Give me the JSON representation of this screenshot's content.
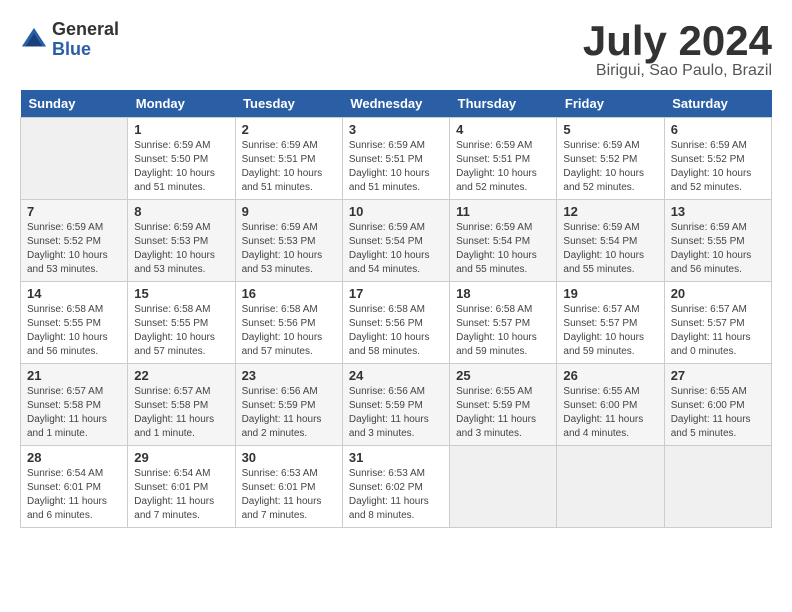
{
  "header": {
    "logo_general": "General",
    "logo_blue": "Blue",
    "title": "July 2024",
    "location": "Birigui, Sao Paulo, Brazil"
  },
  "calendar": {
    "days_of_week": [
      "Sunday",
      "Monday",
      "Tuesday",
      "Wednesday",
      "Thursday",
      "Friday",
      "Saturday"
    ],
    "weeks": [
      [
        {
          "day": "",
          "empty": true
        },
        {
          "day": "1",
          "sunrise": "Sunrise: 6:59 AM",
          "sunset": "Sunset: 5:50 PM",
          "daylight": "Daylight: 10 hours and 51 minutes."
        },
        {
          "day": "2",
          "sunrise": "Sunrise: 6:59 AM",
          "sunset": "Sunset: 5:51 PM",
          "daylight": "Daylight: 10 hours and 51 minutes."
        },
        {
          "day": "3",
          "sunrise": "Sunrise: 6:59 AM",
          "sunset": "Sunset: 5:51 PM",
          "daylight": "Daylight: 10 hours and 51 minutes."
        },
        {
          "day": "4",
          "sunrise": "Sunrise: 6:59 AM",
          "sunset": "Sunset: 5:51 PM",
          "daylight": "Daylight: 10 hours and 52 minutes."
        },
        {
          "day": "5",
          "sunrise": "Sunrise: 6:59 AM",
          "sunset": "Sunset: 5:52 PM",
          "daylight": "Daylight: 10 hours and 52 minutes."
        },
        {
          "day": "6",
          "sunrise": "Sunrise: 6:59 AM",
          "sunset": "Sunset: 5:52 PM",
          "daylight": "Daylight: 10 hours and 52 minutes."
        }
      ],
      [
        {
          "day": "7",
          "sunrise": "Sunrise: 6:59 AM",
          "sunset": "Sunset: 5:52 PM",
          "daylight": "Daylight: 10 hours and 53 minutes."
        },
        {
          "day": "8",
          "sunrise": "Sunrise: 6:59 AM",
          "sunset": "Sunset: 5:53 PM",
          "daylight": "Daylight: 10 hours and 53 minutes."
        },
        {
          "day": "9",
          "sunrise": "Sunrise: 6:59 AM",
          "sunset": "Sunset: 5:53 PM",
          "daylight": "Daylight: 10 hours and 53 minutes."
        },
        {
          "day": "10",
          "sunrise": "Sunrise: 6:59 AM",
          "sunset": "Sunset: 5:54 PM",
          "daylight": "Daylight: 10 hours and 54 minutes."
        },
        {
          "day": "11",
          "sunrise": "Sunrise: 6:59 AM",
          "sunset": "Sunset: 5:54 PM",
          "daylight": "Daylight: 10 hours and 55 minutes."
        },
        {
          "day": "12",
          "sunrise": "Sunrise: 6:59 AM",
          "sunset": "Sunset: 5:54 PM",
          "daylight": "Daylight: 10 hours and 55 minutes."
        },
        {
          "day": "13",
          "sunrise": "Sunrise: 6:59 AM",
          "sunset": "Sunset: 5:55 PM",
          "daylight": "Daylight: 10 hours and 56 minutes."
        }
      ],
      [
        {
          "day": "14",
          "sunrise": "Sunrise: 6:58 AM",
          "sunset": "Sunset: 5:55 PM",
          "daylight": "Daylight: 10 hours and 56 minutes."
        },
        {
          "day": "15",
          "sunrise": "Sunrise: 6:58 AM",
          "sunset": "Sunset: 5:55 PM",
          "daylight": "Daylight: 10 hours and 57 minutes."
        },
        {
          "day": "16",
          "sunrise": "Sunrise: 6:58 AM",
          "sunset": "Sunset: 5:56 PM",
          "daylight": "Daylight: 10 hours and 57 minutes."
        },
        {
          "day": "17",
          "sunrise": "Sunrise: 6:58 AM",
          "sunset": "Sunset: 5:56 PM",
          "daylight": "Daylight: 10 hours and 58 minutes."
        },
        {
          "day": "18",
          "sunrise": "Sunrise: 6:58 AM",
          "sunset": "Sunset: 5:57 PM",
          "daylight": "Daylight: 10 hours and 59 minutes."
        },
        {
          "day": "19",
          "sunrise": "Sunrise: 6:57 AM",
          "sunset": "Sunset: 5:57 PM",
          "daylight": "Daylight: 10 hours and 59 minutes."
        },
        {
          "day": "20",
          "sunrise": "Sunrise: 6:57 AM",
          "sunset": "Sunset: 5:57 PM",
          "daylight": "Daylight: 11 hours and 0 minutes."
        }
      ],
      [
        {
          "day": "21",
          "sunrise": "Sunrise: 6:57 AM",
          "sunset": "Sunset: 5:58 PM",
          "daylight": "Daylight: 11 hours and 1 minute."
        },
        {
          "day": "22",
          "sunrise": "Sunrise: 6:57 AM",
          "sunset": "Sunset: 5:58 PM",
          "daylight": "Daylight: 11 hours and 1 minute."
        },
        {
          "day": "23",
          "sunrise": "Sunrise: 6:56 AM",
          "sunset": "Sunset: 5:59 PM",
          "daylight": "Daylight: 11 hours and 2 minutes."
        },
        {
          "day": "24",
          "sunrise": "Sunrise: 6:56 AM",
          "sunset": "Sunset: 5:59 PM",
          "daylight": "Daylight: 11 hours and 3 minutes."
        },
        {
          "day": "25",
          "sunrise": "Sunrise: 6:55 AM",
          "sunset": "Sunset: 5:59 PM",
          "daylight": "Daylight: 11 hours and 3 minutes."
        },
        {
          "day": "26",
          "sunrise": "Sunrise: 6:55 AM",
          "sunset": "Sunset: 6:00 PM",
          "daylight": "Daylight: 11 hours and 4 minutes."
        },
        {
          "day": "27",
          "sunrise": "Sunrise: 6:55 AM",
          "sunset": "Sunset: 6:00 PM",
          "daylight": "Daylight: 11 hours and 5 minutes."
        }
      ],
      [
        {
          "day": "28",
          "sunrise": "Sunrise: 6:54 AM",
          "sunset": "Sunset: 6:01 PM",
          "daylight": "Daylight: 11 hours and 6 minutes."
        },
        {
          "day": "29",
          "sunrise": "Sunrise: 6:54 AM",
          "sunset": "Sunset: 6:01 PM",
          "daylight": "Daylight: 11 hours and 7 minutes."
        },
        {
          "day": "30",
          "sunrise": "Sunrise: 6:53 AM",
          "sunset": "Sunset: 6:01 PM",
          "daylight": "Daylight: 11 hours and 7 minutes."
        },
        {
          "day": "31",
          "sunrise": "Sunrise: 6:53 AM",
          "sunset": "Sunset: 6:02 PM",
          "daylight": "Daylight: 11 hours and 8 minutes."
        },
        {
          "day": "",
          "empty": true
        },
        {
          "day": "",
          "empty": true
        },
        {
          "day": "",
          "empty": true
        }
      ]
    ]
  }
}
